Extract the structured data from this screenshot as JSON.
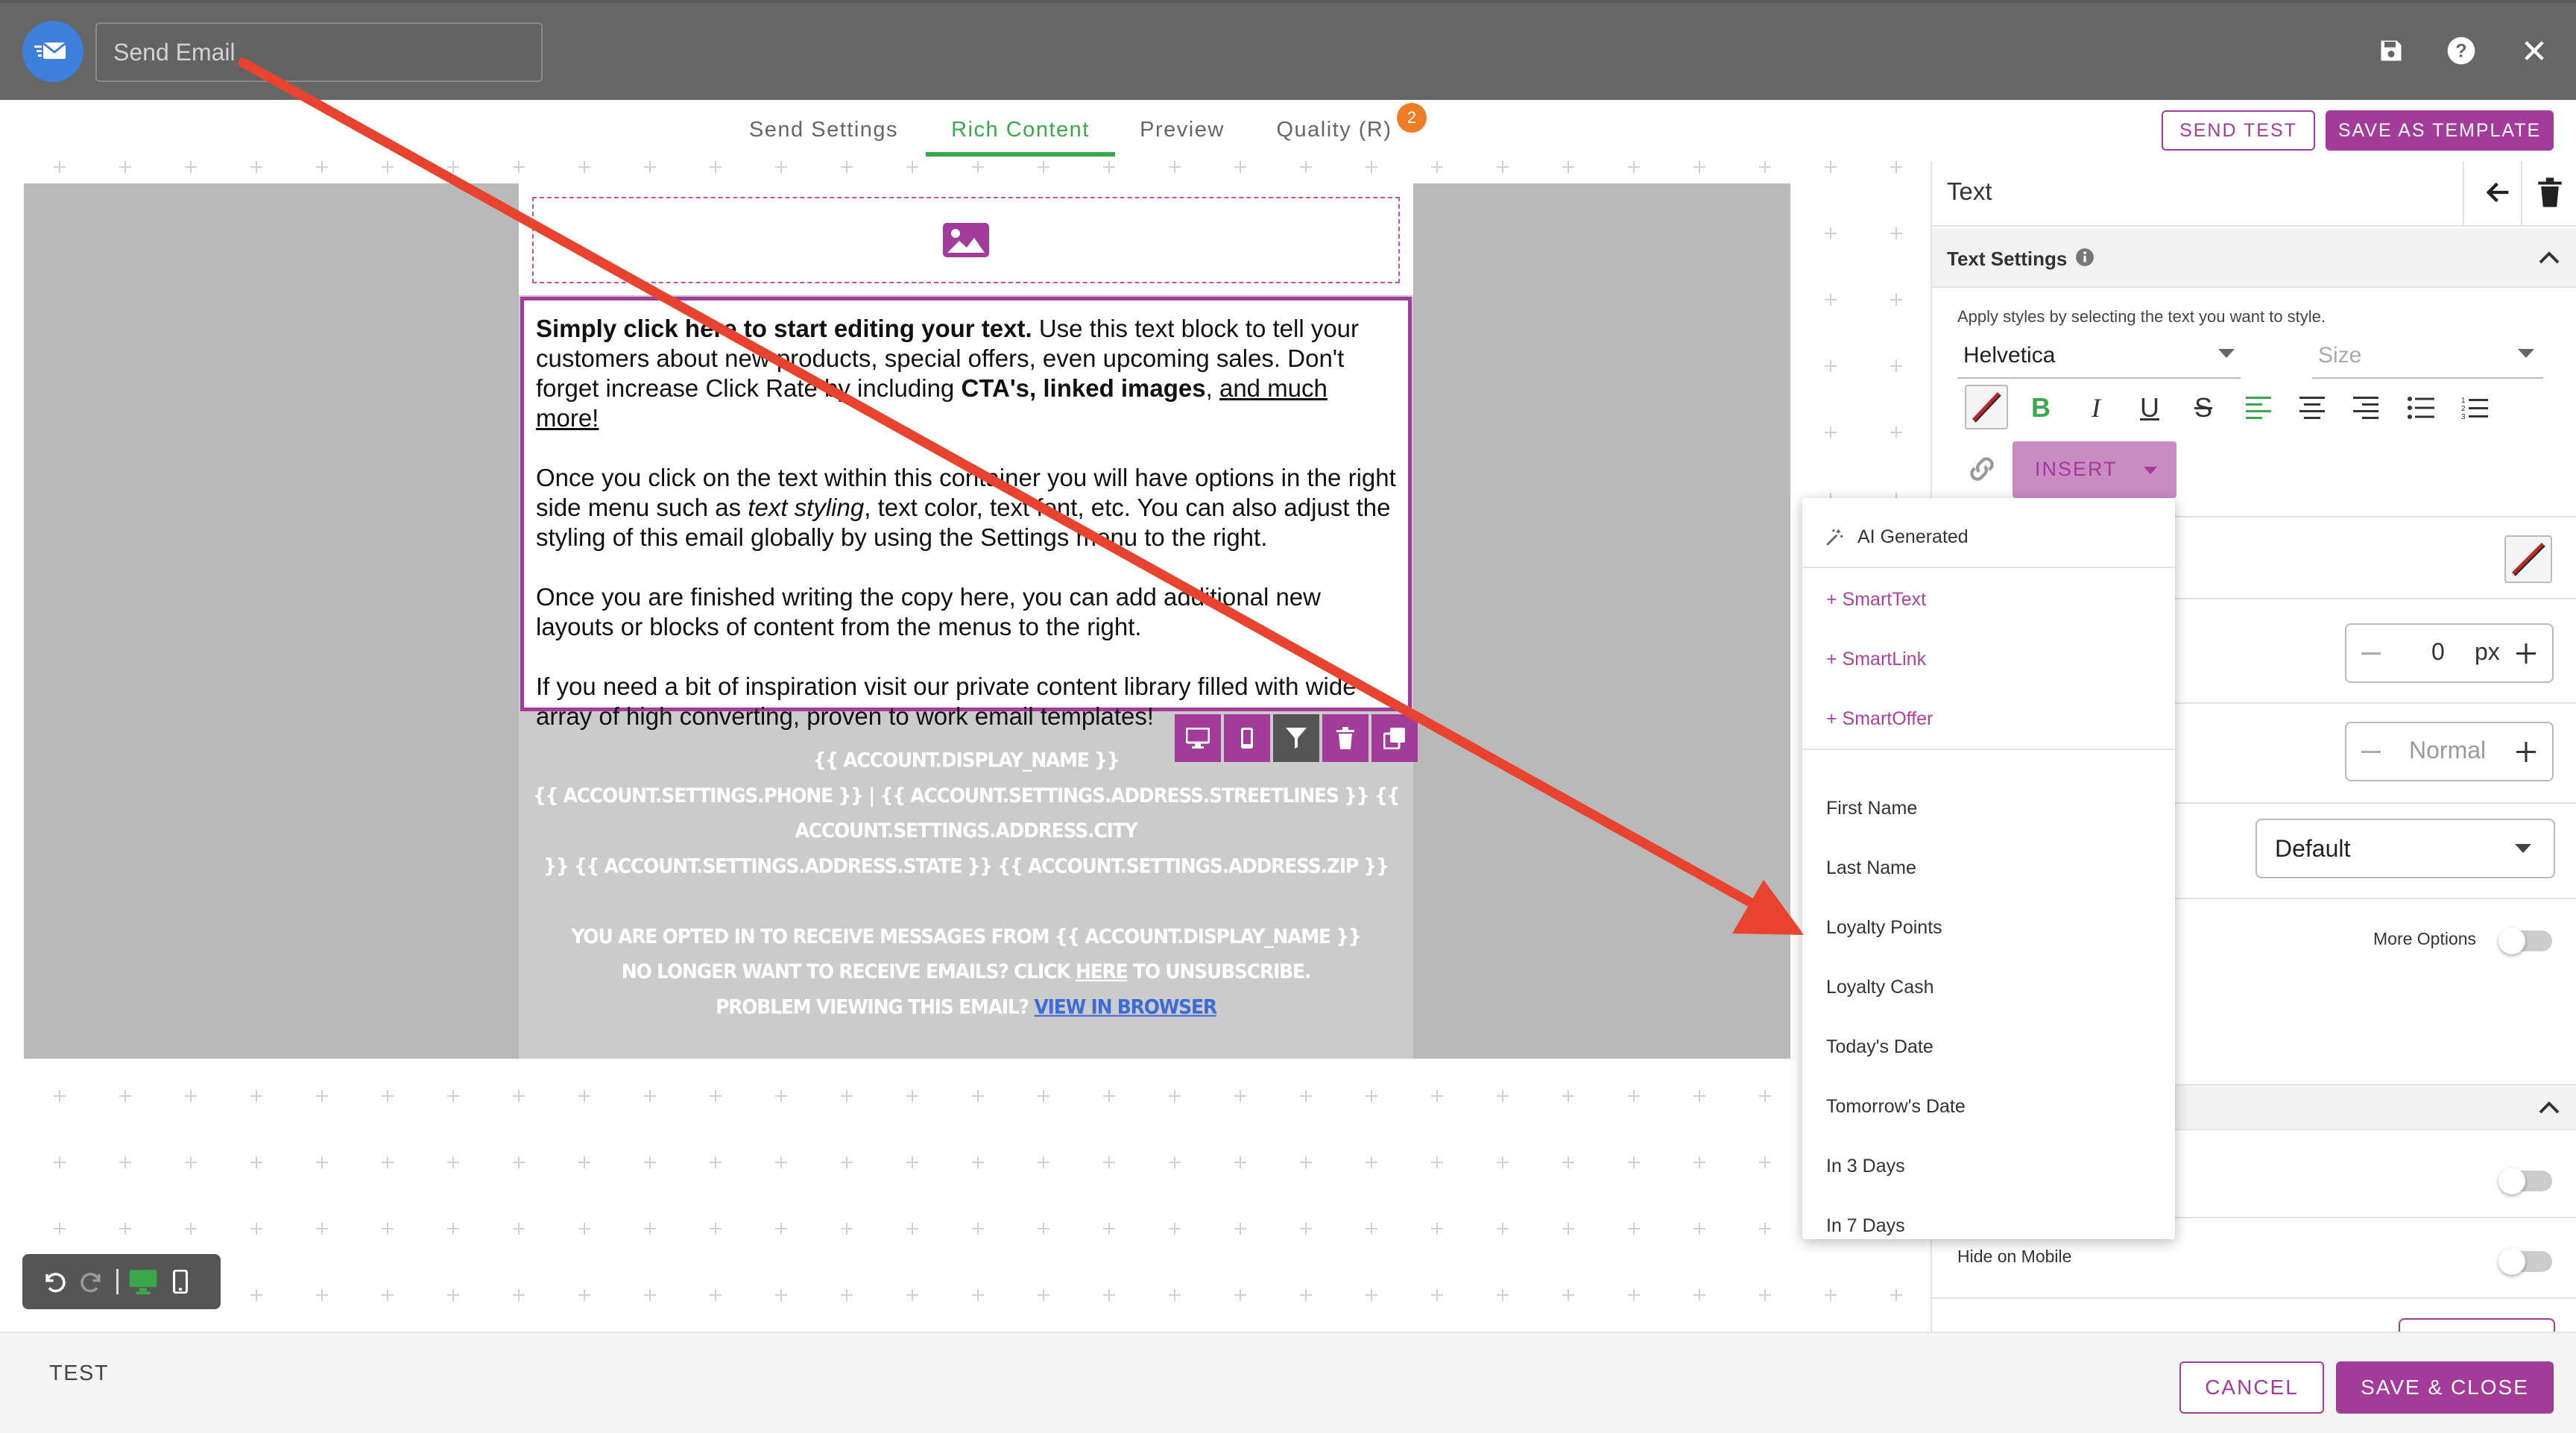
{
  "header": {
    "title_placeholder": "Send Email",
    "icons": [
      "email-logo-icon",
      "save-icon",
      "help-icon",
      "close-icon"
    ]
  },
  "tabs": [
    {
      "label": "Send Settings",
      "active": false
    },
    {
      "label": "Rich Content",
      "active": true
    },
    {
      "label": "Preview",
      "active": false
    },
    {
      "label": "Quality (R)",
      "active": false,
      "badge": "2"
    }
  ],
  "actions": {
    "send_test": "SEND TEST",
    "save_as_template": "SAVE AS TEMPLATE",
    "cancel": "CANCEL",
    "save_close": "SAVE & CLOSE"
  },
  "email": {
    "paragraph1": {
      "bold_lead": "Simply click here to start editing your text.",
      "text_a": " Use this text block to tell your customers about new products, special offers, even upcoming sales. Don't forget increase Click Rate by including ",
      "bold_cta": "CTA's, linked images",
      "text_b": ", ",
      "underlined": "and much more!"
    },
    "paragraph2": {
      "text_a": "Once you click on the text within this container you will have options in the right side menu such as ",
      "italic": "text styling",
      "text_b": ", text color, text font, etc. You can also adjust the styling of this email globally by using the Settings menu to the right."
    },
    "paragraph3": "Once you are finished writing the copy here, you can add additional new layouts or blocks of content from the menus to the right.",
    "paragraph4": "If you need a bit of inspiration visit our private content library filled with wide array of high converting, proven to work email templates!",
    "footer": {
      "line1": "{{ ACCOUNT.DISPLAY_NAME }}",
      "line2": "{{ ACCOUNT.SETTINGS.PHONE }} | {{ ACCOUNT.SETTINGS.ADDRESS.STREETLINES }} {{ ACCOUNT.SETTINGS.ADDRESS.CITY",
      "line3": "}} {{ ACCOUNT.SETTINGS.ADDRESS.STATE }} {{ ACCOUNT.SETTINGS.ADDRESS.ZIP }}",
      "line4": "YOU ARE OPTED IN TO RECEIVE MESSAGES FROM {{ ACCOUNT.DISPLAY_NAME }}",
      "line5_a": "NO LONGER WANT TO RECEIVE EMAILS? CLICK ",
      "line5_link": "HERE",
      "line5_b": " TO UNSUBSCRIBE.",
      "line6_a": "PROBLEM VIEWING THIS EMAIL? ",
      "line6_link": "VIEW IN BROWSER"
    }
  },
  "panel": {
    "title": "Text",
    "section": "Text Settings",
    "hint": "Apply styles by selecting the text you want to style.",
    "font": "Helvetica",
    "size_placeholder": "Size",
    "insert_label": "INSERT",
    "letter_spacing_value": "0",
    "letter_spacing_unit": "px",
    "line_height_value": "Normal",
    "align_value": "Default",
    "more_options": "More Options",
    "hide_on_mobile": "Hide on Mobile"
  },
  "insert_menu": {
    "ai": "AI Generated",
    "smart": [
      "+ SmartText",
      "+ SmartLink",
      "+ SmartOffer"
    ],
    "fields": [
      "First Name",
      "Last Name",
      "Loyalty Points",
      "Loyalty Cash",
      "Today's Date",
      "Tomorrow's Date",
      "In 3 Days",
      "In 7 Days"
    ]
  },
  "bottom": {
    "label": "TEST"
  },
  "colors": {
    "accent": "#a33b9a",
    "active_tab": "#3aa84a",
    "header": "#666666",
    "annotation_arrow": "#e8432e",
    "badge": "#ef7d26"
  }
}
